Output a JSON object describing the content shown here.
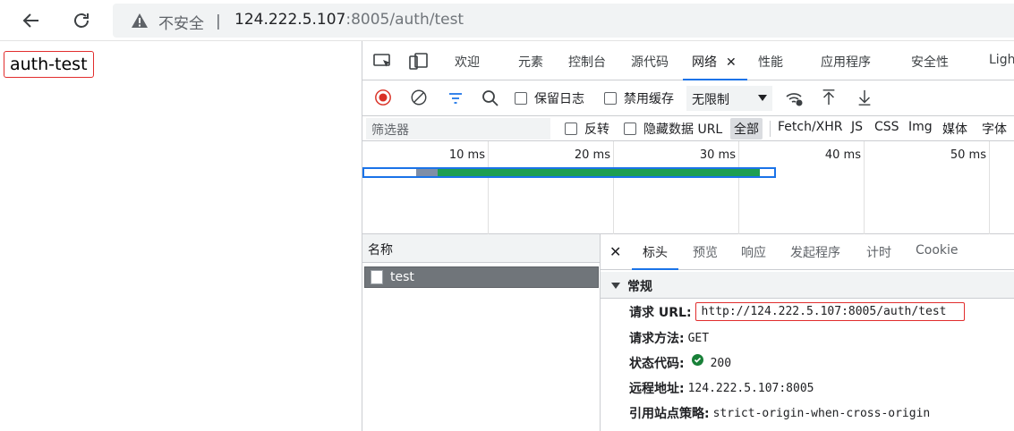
{
  "browser": {
    "security_label": "不安全",
    "separator": "|",
    "url_host": "124.222.5.107",
    "url_rest": ":8005/auth/test"
  },
  "page": {
    "text": "auth-test"
  },
  "devtools": {
    "tabs": [
      {
        "label": "欢迎"
      },
      {
        "label": "元素"
      },
      {
        "label": "控制台"
      },
      {
        "label": "源代码"
      },
      {
        "label": "网络",
        "active": true
      },
      {
        "label": "性能"
      },
      {
        "label": "应用程序"
      },
      {
        "label": "安全性"
      },
      {
        "label": "Ligh"
      }
    ],
    "tab_close": "✕",
    "toolbar": {
      "preserve_log": "保留日志",
      "disable_cache": "禁用缓存",
      "throttling": "无限制"
    },
    "filter": {
      "placeholder": "筛选器",
      "invert": "反转",
      "hide_data_urls": "隐藏数据 URL",
      "types": [
        "全部",
        "Fetch/XHR",
        "JS",
        "CSS",
        "Img",
        "媒体",
        "字体"
      ]
    },
    "timeline": {
      "ticks": [
        "10 ms",
        "20 ms",
        "30 ms",
        "40 ms",
        "50 ms"
      ]
    },
    "requests": {
      "header": "名称",
      "rows": [
        {
          "name": "test"
        }
      ]
    },
    "detail": {
      "close": "✕",
      "tabs": [
        "标头",
        "预览",
        "响应",
        "发起程序",
        "计时",
        "Cookie"
      ],
      "section": "常规",
      "fields": {
        "request_url_key": "请求 URL:",
        "request_url": "http://124.222.5.107:8005/auth/test",
        "method_key": "请求方法:",
        "method": "GET",
        "status_key": "状态代码:",
        "status": "200",
        "remote_key": "远程地址:",
        "remote": "124.222.5.107:8005",
        "referrer_key": "引用站点策略:",
        "referrer": "strict-origin-when-cross-origin"
      }
    }
  },
  "colors": {
    "accent": "#1a73e8",
    "record": "#d93025",
    "ok": "#188038",
    "highlight_border": "#e12d2d"
  }
}
